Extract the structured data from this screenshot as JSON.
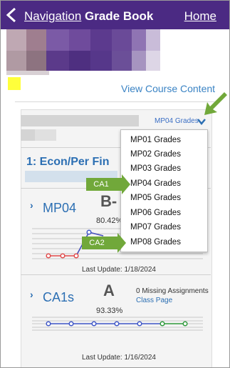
{
  "header": {
    "nav_label": "Navigation",
    "title": "Grade Book",
    "home_label": "Home"
  },
  "view_course_content": "View Course Content",
  "marking_period_select": {
    "label": "MP04 Grades"
  },
  "course": {
    "title": "1: Econ/Per Fin"
  },
  "rows": [
    {
      "name": "MP04",
      "grade": "B-",
      "percent": "80.42%",
      "last_update": "Last Update: 1/18/2024"
    },
    {
      "name": "CA1s",
      "grade": "A",
      "percent": "93.33%",
      "missing": "0 Missing Assignments",
      "class_page": "Class Page",
      "last_update": "Last Update: 1/16/2024"
    }
  ],
  "dropdown_options": [
    "MP01 Grades",
    "MP02 Grades",
    "MP03 Grades",
    "MP04 Grades",
    "MP05 Grades",
    "MP06 Grades",
    "MP07 Grades",
    "MP08 Grades"
  ],
  "callouts": {
    "ca1": "CA1",
    "ca2": "CA2"
  },
  "colors": {
    "header": "#4b2a83",
    "link": "#2c6fb3",
    "callout": "#71a83a",
    "highlight": "#ffff3b"
  }
}
